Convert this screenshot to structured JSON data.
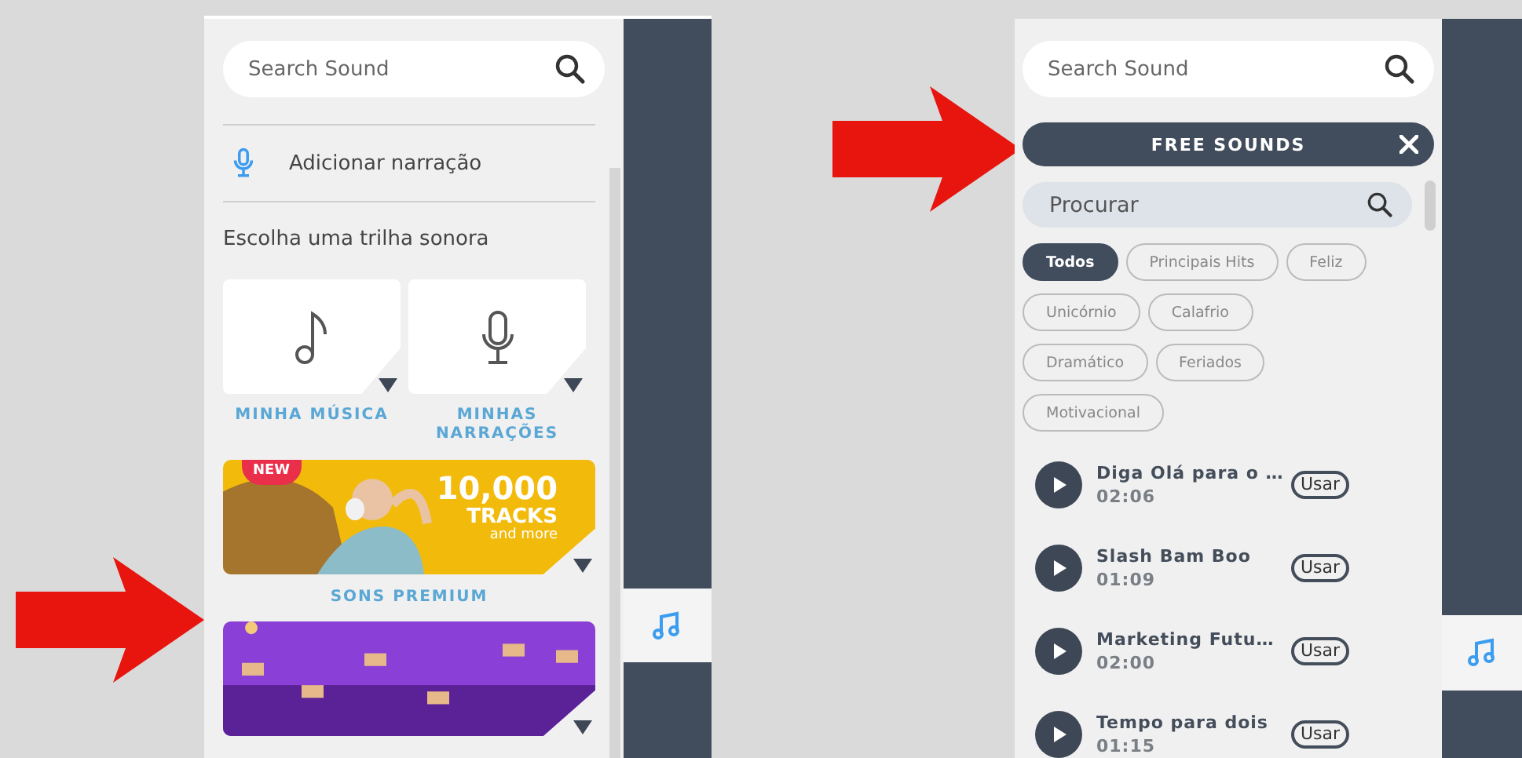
{
  "left_panel": {
    "search": {
      "placeholder": "Search Sound"
    },
    "narration": {
      "label": "Adicionar narração"
    },
    "heading": "Escolha uma trilha sonora",
    "tiles": [
      {
        "kind": "music",
        "label": "MINHA MÚSICA"
      },
      {
        "kind": "mic",
        "label": "MINHAS NARRAÇÕES"
      }
    ],
    "banners": [
      {
        "kind": "premium",
        "badge": "NEW",
        "headline": "10,000",
        "subline": "TRACKS",
        "tagline": "and more",
        "label": "SONS PREMIUM"
      },
      {
        "kind": "mixer"
      }
    ]
  },
  "right_panel": {
    "search": {
      "placeholder": "Search Sound"
    },
    "category_bar": {
      "title": "FREE SOUNDS"
    },
    "filter": {
      "placeholder": "Procurar"
    },
    "chips": [
      {
        "label": "Todos",
        "selected": true
      },
      {
        "label": "Principais Hits",
        "selected": false
      },
      {
        "label": "Feliz",
        "selected": false
      },
      {
        "label": "Unicórnio",
        "selected": false
      },
      {
        "label": "Calafrio",
        "selected": false
      },
      {
        "label": "Dramático",
        "selected": false
      },
      {
        "label": "Feriados",
        "selected": false
      },
      {
        "label": "Motivacional",
        "selected": false
      }
    ],
    "tracks": [
      {
        "title": "Diga Olá para o …",
        "duration": "02:06",
        "action": "Usar"
      },
      {
        "title": "Slash Bam Boo",
        "duration": "01:09",
        "action": "Usar"
      },
      {
        "title": "Marketing Futu…",
        "duration": "02:00",
        "action": "Usar"
      },
      {
        "title": "Tempo para dois",
        "duration": "01:15",
        "action": "Usar"
      }
    ]
  }
}
